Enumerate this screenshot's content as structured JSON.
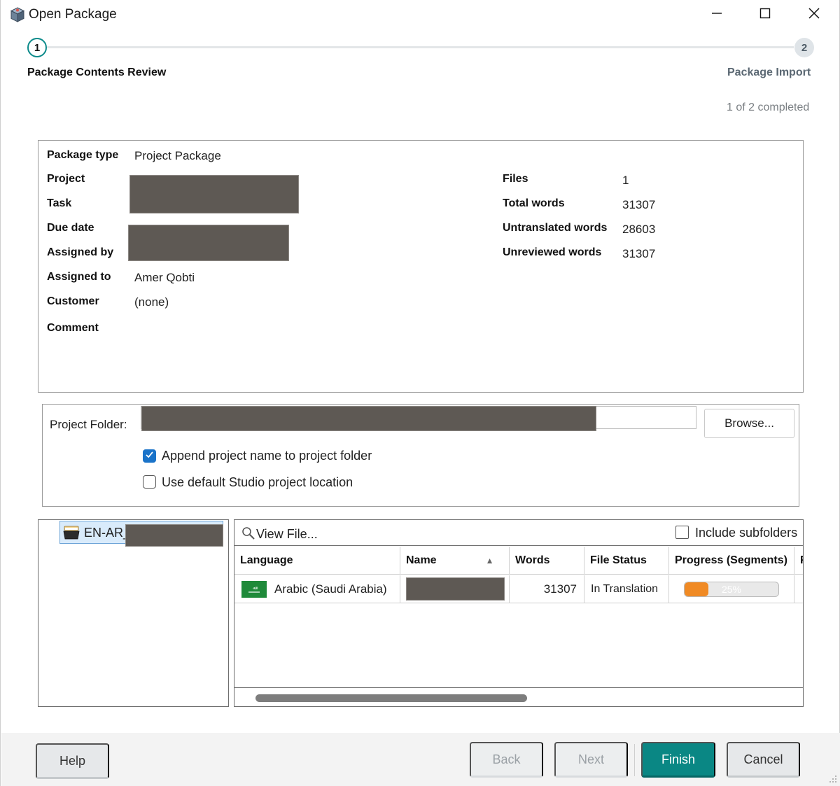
{
  "window": {
    "title": "Open Package",
    "icon": "package-box-icon",
    "controls": {
      "minimize": "minimize-icon",
      "maximize": "maximize-icon",
      "close": "close-icon"
    }
  },
  "wizard": {
    "steps": [
      {
        "number": "1",
        "label": "Package Contents Review",
        "state": "active"
      },
      {
        "number": "2",
        "label": "Package Import",
        "state": "pending"
      }
    ],
    "progress_text": "1 of 2 completed"
  },
  "package_info": {
    "left": [
      {
        "label": "Package type",
        "value": "Project Package"
      },
      {
        "label": "Project",
        "value": ""
      },
      {
        "label": "Task",
        "value": ""
      },
      {
        "label": "Due date",
        "value": ""
      },
      {
        "label": "Assigned by",
        "value": ""
      },
      {
        "label": "Assigned to",
        "value": "Amer Qobti"
      },
      {
        "label": "Customer",
        "value": "(none)"
      },
      {
        "label": "Comment",
        "value": ""
      }
    ],
    "right": [
      {
        "label": "Files",
        "value": "1"
      },
      {
        "label": "Total words",
        "value": "31307"
      },
      {
        "label": "Untranslated words",
        "value": "28603"
      },
      {
        "label": "Unreviewed words",
        "value": "31307"
      }
    ]
  },
  "project_folder": {
    "label": "Project Folder:",
    "browse_label": "Browse...",
    "append_name": {
      "label": "Append project name to project folder",
      "checked": true
    },
    "use_default": {
      "label": "Use default Studio project location",
      "checked": false
    }
  },
  "tree": {
    "item_label": "EN-AR_",
    "item_icon": "project-folder-icon"
  },
  "file_grid": {
    "view_file_label": "View File...",
    "include_subfolders": {
      "label": "Include subfolders",
      "checked": false
    },
    "columns": [
      "Language",
      "Name",
      "Words",
      "File Status",
      "Progress (Segments)",
      "F"
    ],
    "sort_indicator": "▲",
    "rows": [
      {
        "language": "Arabic (Saudi Arabia)",
        "flag_icon": "saudi-arabia-flag-icon",
        "name": "",
        "words": "31307",
        "file_status": "In Translation",
        "progress_text": "25%",
        "progress_value": 0.25,
        "progress_color": "#f08a24"
      }
    ]
  },
  "footer": {
    "help": "Help",
    "back": "Back",
    "next": "Next",
    "finish": "Finish",
    "cancel": "Cancel",
    "accent_color": "#0a8784"
  }
}
